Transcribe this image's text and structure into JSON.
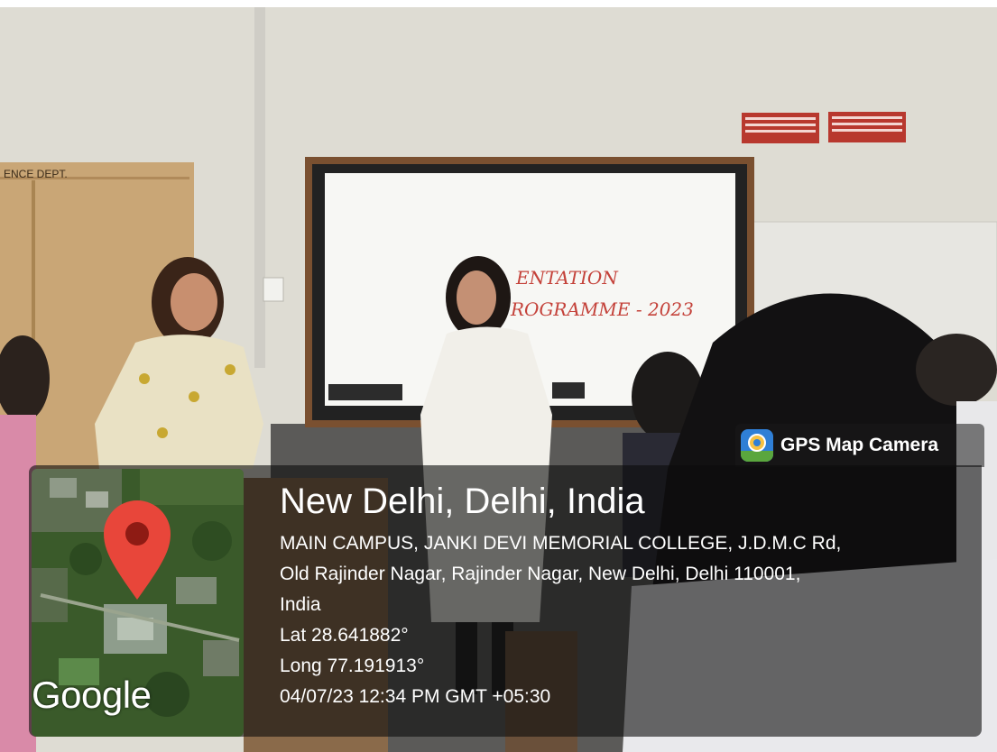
{
  "photo": {
    "wall_sign": "ENCE DEPT.",
    "board_text_line1": "ENTATION",
    "board_text_line2": "ROGRAMME - 2023"
  },
  "overlay": {
    "app_name": "GPS Map Camera",
    "map_brand": "Google",
    "location_title": "New Delhi, Delhi, India",
    "address_lines": [
      "MAIN CAMPUS, JANKI DEVI MEMORIAL COLLEGE, J.D.M.C Rd,",
      "Old Rajinder Nagar, Rajinder Nagar, New Delhi, Delhi 110001,",
      "India"
    ],
    "latitude": "Lat 28.641882°",
    "longitude": "Long 77.191913°",
    "timestamp": "04/07/23 12:34 PM GMT +05:30"
  },
  "colors": {
    "pin_red": "#e8463a",
    "map_green": "#3a5a2a",
    "board_frame": "#7a5030"
  }
}
